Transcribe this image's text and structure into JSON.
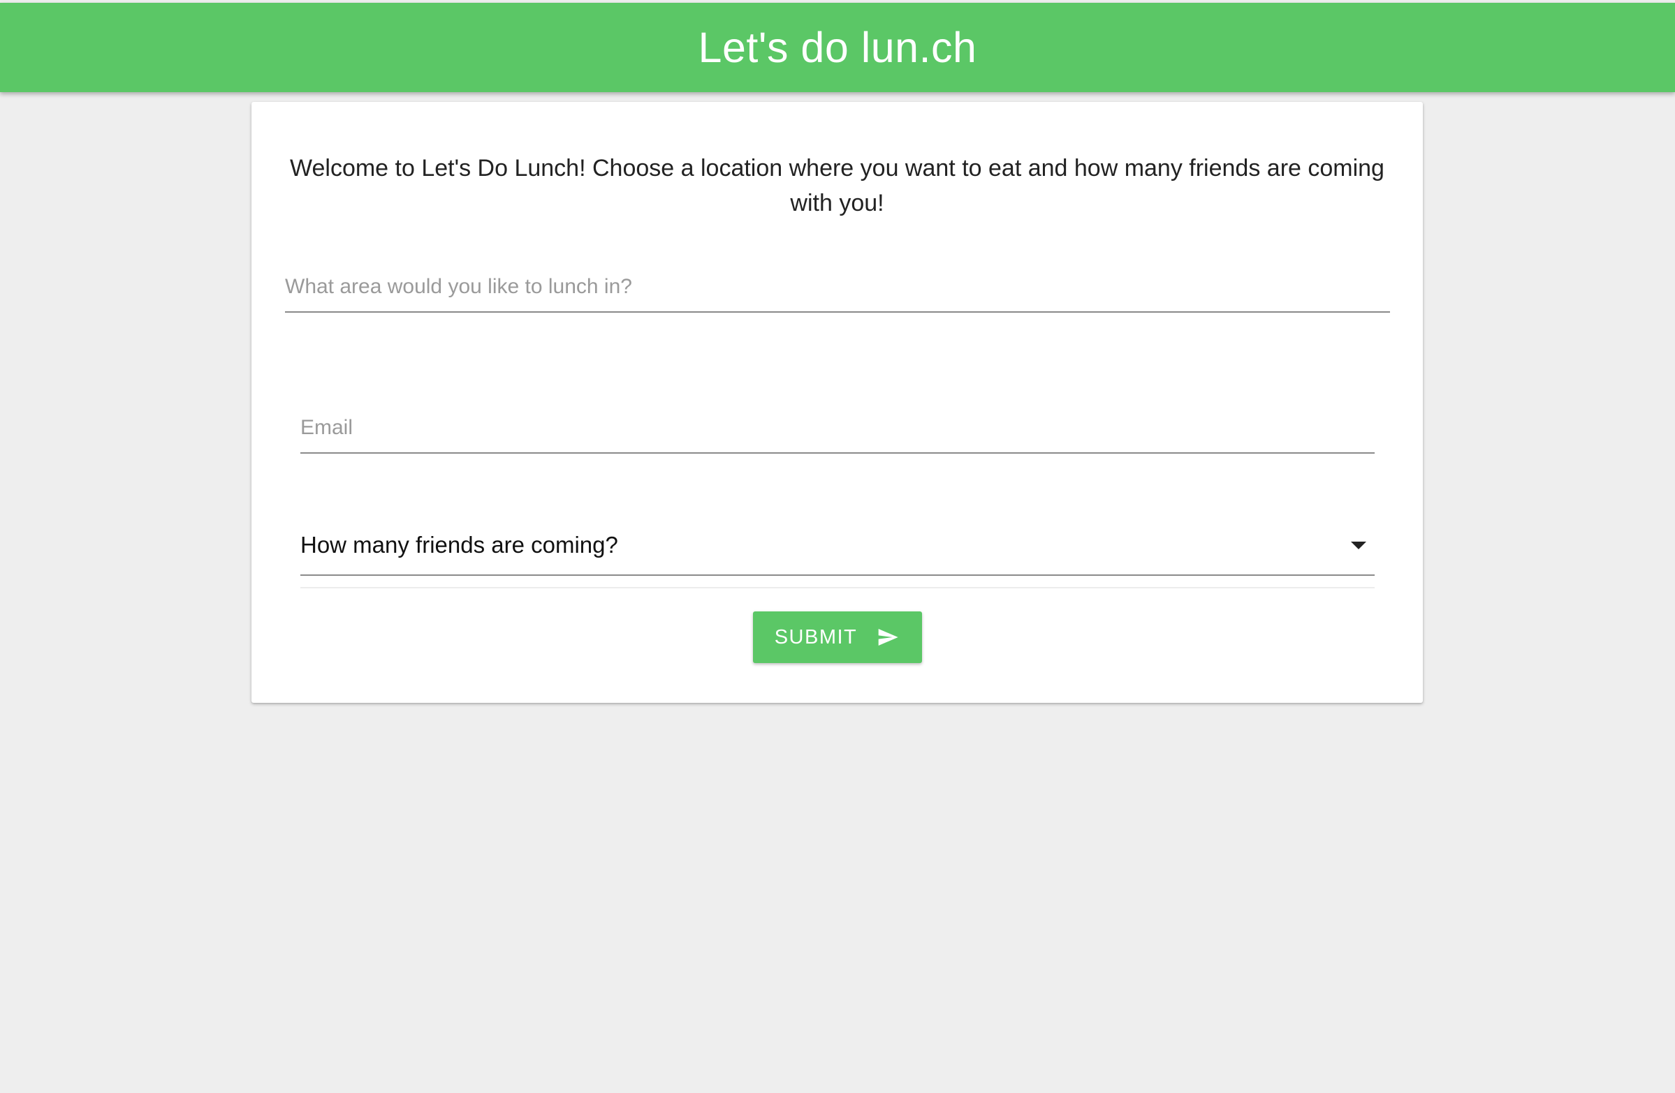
{
  "header": {
    "title": "Let's do lun.ch"
  },
  "form": {
    "welcome_text": "Welcome to Let's Do Lunch! Choose a location where you want to eat and how many friends are coming with you!",
    "area_placeholder": "What area would you like to lunch in?",
    "area_value": "",
    "email_placeholder": "Email",
    "email_value": "",
    "friends_select_label": "How many friends are coming?",
    "submit_label": "SUBMIT"
  },
  "icons": {
    "select_caret": "caret-down-icon",
    "submit": "send-icon"
  },
  "colors": {
    "brand_green": "#5bc766",
    "page_background": "#eeeeee",
    "card_background": "#ffffff"
  }
}
